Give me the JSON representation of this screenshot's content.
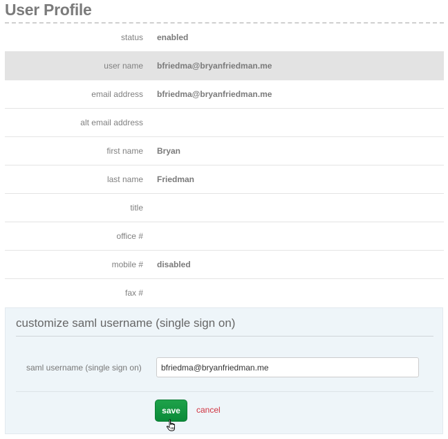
{
  "page": {
    "title": "User Profile"
  },
  "profile": {
    "rows": [
      {
        "label": "status",
        "value": "enabled",
        "highlight": false
      },
      {
        "label": "user name",
        "value": "bfriedma@bryanfriedman.me",
        "highlight": true
      },
      {
        "label": "email address",
        "value": "bfriedma@bryanfriedman.me",
        "highlight": false
      },
      {
        "label": "alt email address",
        "value": "",
        "highlight": false
      },
      {
        "label": "first name",
        "value": "Bryan",
        "highlight": false
      },
      {
        "label": "last name",
        "value": "Friedman",
        "highlight": false
      },
      {
        "label": "title",
        "value": "",
        "highlight": false
      },
      {
        "label": "office #",
        "value": "",
        "highlight": false
      },
      {
        "label": "mobile #",
        "value": "disabled",
        "highlight": false
      },
      {
        "label": "fax #",
        "value": "",
        "highlight": false
      }
    ]
  },
  "saml_panel": {
    "title": "customize saml username (single sign on)",
    "field_label": "saml username (single sign on)",
    "field_value": "bfriedma@bryanfriedman.me",
    "save_label": "save",
    "cancel_label": "cancel"
  },
  "colors": {
    "save_green": "#0f9440",
    "cancel_red": "#d0323f",
    "highlight_row": "#e3e3e3",
    "panel_bg": "#eef5f9"
  },
  "cursor": {
    "icon": "hand-pointer-icon"
  }
}
